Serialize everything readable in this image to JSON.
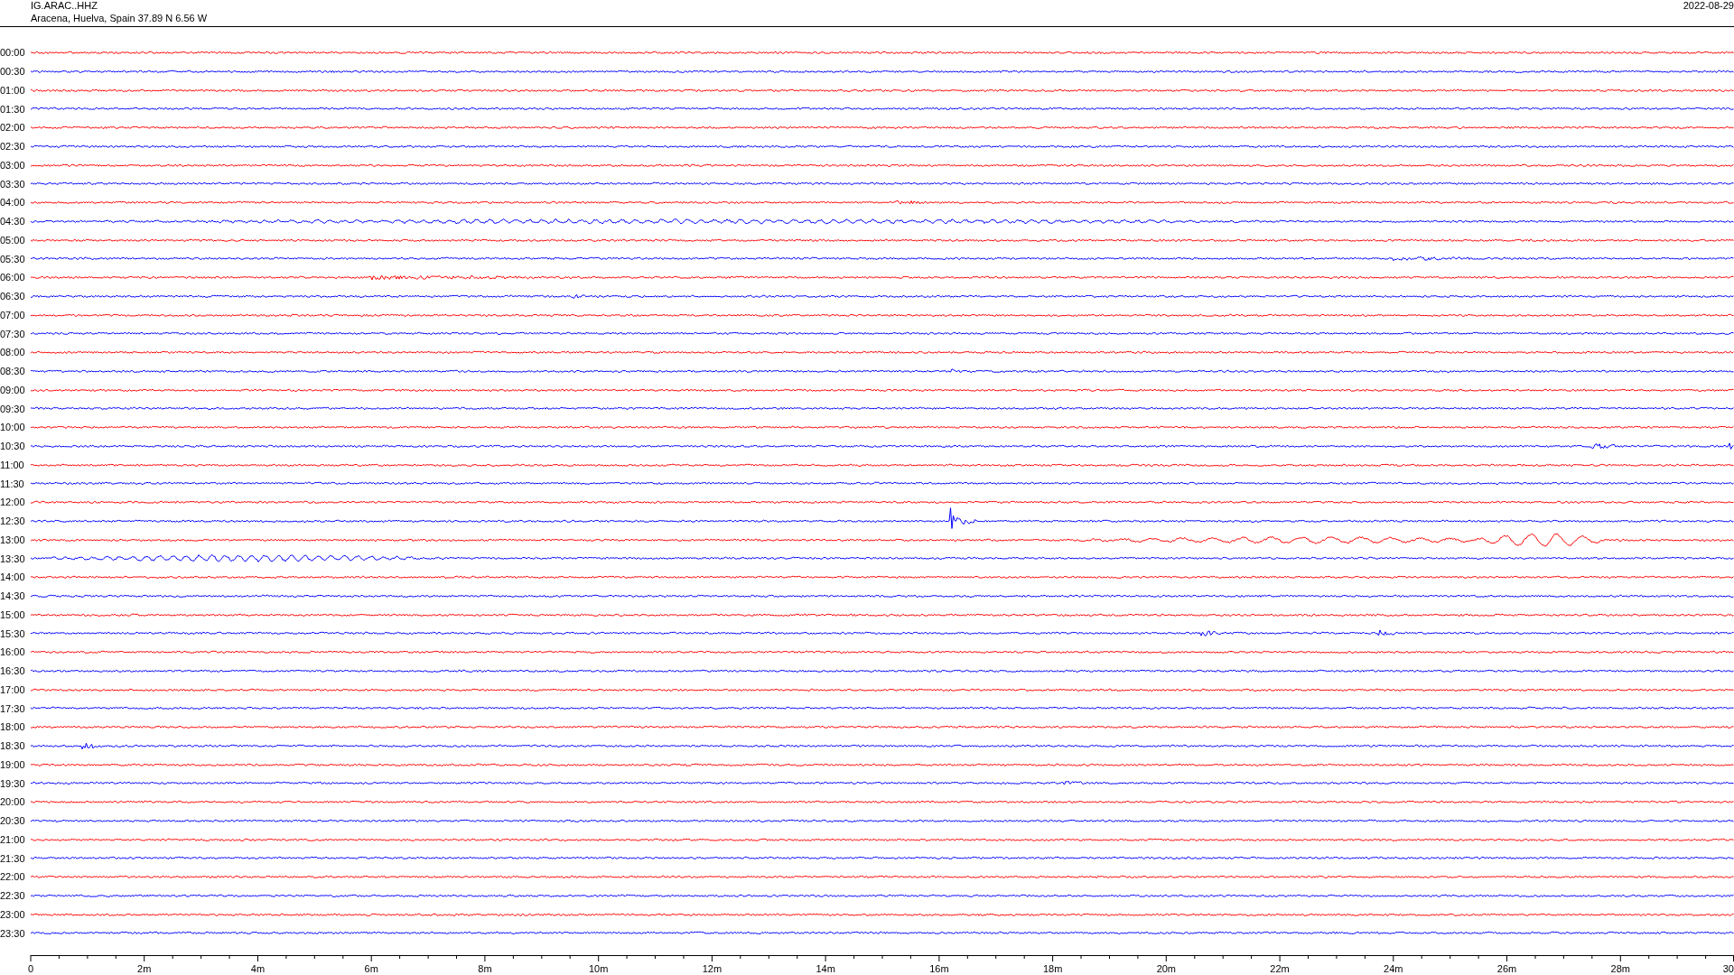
{
  "header": {
    "station": "IG.ARAC..HHZ",
    "location": "Aracena, Huelva, Spain  37.89 N 6.56 W",
    "date": "2022-08-29"
  },
  "rows": [
    {
      "time": "00:00",
      "color": "#ff0000"
    },
    {
      "time": "00:30",
      "color": "#0000ff"
    },
    {
      "time": "01:00",
      "color": "#ff0000"
    },
    {
      "time": "01:30",
      "color": "#0000ff"
    },
    {
      "time": "02:00",
      "color": "#ff0000"
    },
    {
      "time": "02:30",
      "color": "#0000ff"
    },
    {
      "time": "03:00",
      "color": "#ff0000"
    },
    {
      "time": "03:30",
      "color": "#0000ff"
    },
    {
      "time": "04:00",
      "color": "#ff0000"
    },
    {
      "time": "04:30",
      "color": "#0000ff"
    },
    {
      "time": "05:00",
      "color": "#ff0000"
    },
    {
      "time": "05:30",
      "color": "#0000ff"
    },
    {
      "time": "06:00",
      "color": "#ff0000"
    },
    {
      "time": "06:30",
      "color": "#0000ff"
    },
    {
      "time": "07:00",
      "color": "#ff0000"
    },
    {
      "time": "07:30",
      "color": "#0000ff"
    },
    {
      "time": "08:00",
      "color": "#ff0000"
    },
    {
      "time": "08:30",
      "color": "#0000ff"
    },
    {
      "time": "09:00",
      "color": "#ff0000"
    },
    {
      "time": "09:30",
      "color": "#0000ff"
    },
    {
      "time": "10:00",
      "color": "#ff0000"
    },
    {
      "time": "10:30",
      "color": "#0000ff"
    },
    {
      "time": "11:00",
      "color": "#ff0000"
    },
    {
      "time": "11:30",
      "color": "#0000ff"
    },
    {
      "time": "12:00",
      "color": "#ff0000"
    },
    {
      "time": "12:30",
      "color": "#0000ff"
    },
    {
      "time": "13:00",
      "color": "#ff0000"
    },
    {
      "time": "13:30",
      "color": "#0000ff"
    },
    {
      "time": "14:00",
      "color": "#ff0000"
    },
    {
      "time": "14:30",
      "color": "#0000ff"
    },
    {
      "time": "15:00",
      "color": "#ff0000"
    },
    {
      "time": "15:30",
      "color": "#0000ff"
    },
    {
      "time": "16:00",
      "color": "#ff0000"
    },
    {
      "time": "16:30",
      "color": "#0000ff"
    },
    {
      "time": "17:00",
      "color": "#ff0000"
    },
    {
      "time": "17:30",
      "color": "#0000ff"
    },
    {
      "time": "18:00",
      "color": "#ff0000"
    },
    {
      "time": "18:30",
      "color": "#0000ff"
    },
    {
      "time": "19:00",
      "color": "#ff0000"
    },
    {
      "time": "19:30",
      "color": "#0000ff"
    },
    {
      "time": "20:00",
      "color": "#ff0000"
    },
    {
      "time": "20:30",
      "color": "#0000ff"
    },
    {
      "time": "21:00",
      "color": "#ff0000"
    },
    {
      "time": "21:30",
      "color": "#0000ff"
    },
    {
      "time": "22:00",
      "color": "#ff0000"
    },
    {
      "time": "22:30",
      "color": "#0000ff"
    },
    {
      "time": "23:00",
      "color": "#ff0000"
    },
    {
      "time": "23:30",
      "color": "#0000ff"
    }
  ],
  "axis": {
    "tick_labels": [
      "0",
      "2m",
      "4m",
      "6m",
      "8m",
      "10m",
      "12m",
      "14m",
      "16m",
      "18m",
      "20m",
      "22m",
      "24m",
      "26m",
      "28m",
      "30"
    ]
  }
}
